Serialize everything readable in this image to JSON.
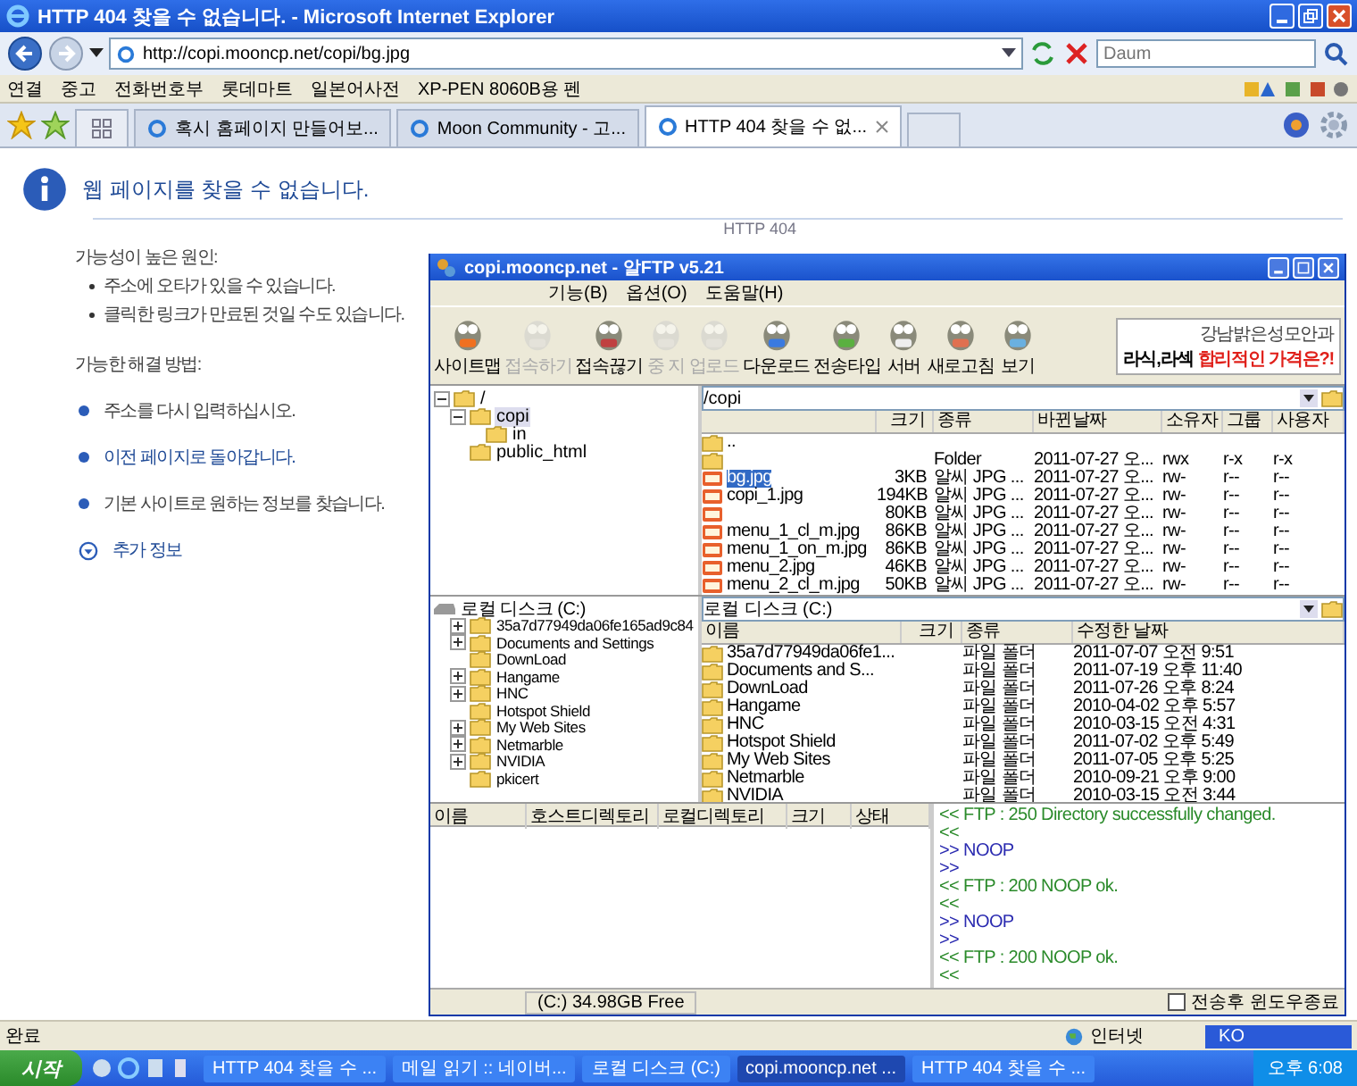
{
  "ie_window": {
    "title": "HTTP 404 찾을 수 없습니다. - Microsoft Internet Explorer"
  },
  "address_bar": {
    "url": "http://copi.mooncp.net/copi/bg.jpg",
    "search_placeholder": "Daum"
  },
  "links_bar": {
    "label": "연결",
    "items": [
      "중고",
      "전화번호부",
      "롯데마트",
      "일본어사전",
      "XP-PEN 8060B용 펜"
    ]
  },
  "tabs": [
    {
      "label": "혹시 홈페이지 만들어보...",
      "selected": false
    },
    {
      "label": "Moon Community - 고...",
      "selected": false
    },
    {
      "label": "HTTP 404 찾을 수 없...",
      "selected": true
    }
  ],
  "error_page": {
    "code": "HTTP 404",
    "heading": "웹 페이지를 찾을 수 없습니다.",
    "causes_label": "가능성이 높은 원인:",
    "causes": [
      "주소에 오타가 있을 수 있습니다.",
      "클릭한 링크가 만료된 것일 수도 있습니다."
    ],
    "solutions_label": "가능한 해결 방법:",
    "solutions": [
      {
        "text": "주소를 다시 입력하십시오.",
        "link": false
      },
      {
        "text": "이전 페이지로 돌아갑니다.",
        "link": true
      },
      {
        "text": "기본 사이트로  원하는 정보를 찾습니다.",
        "link": false
      }
    ],
    "more_info": "추가 정보"
  },
  "ftp": {
    "title": "copi.mooncp.net - 알FTP v5.21",
    "menu": [
      "기능(B)",
      "옵션(O)",
      "도움말(H)"
    ],
    "toolbar": [
      {
        "label": "사이트맵",
        "disabled": false
      },
      {
        "label": "접속하기",
        "disabled": true
      },
      {
        "label": "접속끊기",
        "disabled": false
      },
      {
        "label": "중 지",
        "disabled": true
      },
      {
        "label": "업로드",
        "disabled": true
      },
      {
        "label": "다운로드",
        "disabled": false
      },
      {
        "label": "전송타입",
        "disabled": false
      },
      {
        "label": "서버",
        "disabled": false
      },
      {
        "label": "새로고침",
        "disabled": false
      },
      {
        "label": "보기",
        "disabled": false
      }
    ],
    "ad": {
      "brand": "강남밝은성모안과",
      "headline": "라식,라섹",
      "highlight": "합리적인 가격은?!"
    },
    "remote_tree": [
      {
        "name": "/",
        "selected": false,
        "children": [
          {
            "name": "copi",
            "selected": true,
            "children": [
              {
                "name": "in",
                "selected": false
              }
            ]
          },
          {
            "name": "public_html",
            "selected": false
          }
        ]
      }
    ],
    "remote_path": "/copi",
    "remote_columns": [
      "크기",
      "종류",
      "바뀐날짜",
      "소유자",
      "그룹",
      "사용자"
    ],
    "remote_files": [
      {
        "kind": "folder",
        "name": "..",
        "selected": false
      },
      {
        "kind": "folder",
        "type": "Folder",
        "date": "2011-07-27 오...",
        "owner": "rwx",
        "group": "r-x",
        "user": "r-x"
      },
      {
        "kind": "file",
        "name": "bg.jpg",
        "size": "3KB",
        "type": "알씨 JPG ...",
        "date": "2011-07-27 오...",
        "owner": "rw-",
        "group": "r--",
        "user": "r--",
        "selected": true
      },
      {
        "kind": "file",
        "name": "copi_1.jpg",
        "size": "194KB",
        "type": "알씨 JPG ...",
        "date": "2011-07-27 오...",
        "owner": "rw-",
        "group": "r--",
        "user": "r--",
        "selected": false
      },
      {
        "kind": "file",
        "size": "80KB",
        "type": "알씨 JPG ...",
        "date": "2011-07-27 오...",
        "owner": "rw-",
        "group": "r--",
        "user": "r--"
      },
      {
        "kind": "file",
        "name": "menu_1_cl_m.jpg",
        "size": "86KB",
        "type": "알씨 JPG ...",
        "date": "2011-07-27 오...",
        "owner": "rw-",
        "group": "r--",
        "user": "r--",
        "selected": false
      },
      {
        "kind": "file",
        "name": "menu_1_on_m.jpg",
        "size": "86KB",
        "type": "알씨 JPG ...",
        "date": "2011-07-27 오...",
        "owner": "rw-",
        "group": "r--",
        "user": "r--",
        "selected": false
      },
      {
        "kind": "file",
        "name": "menu_2.jpg",
        "size": "46KB",
        "type": "알씨 JPG ...",
        "date": "2011-07-27 오...",
        "owner": "rw-",
        "group": "r--",
        "user": "r--",
        "selected": false
      },
      {
        "kind": "file",
        "name": "menu_2_cl_m.jpg",
        "size": "50KB",
        "type": "알씨 JPG ...",
        "date": "2011-07-27 오...",
        "owner": "rw-",
        "group": "r--",
        "user": "r--",
        "selected": false
      }
    ],
    "local_tree": [
      {
        "name": "로컬 디스크 (C:)",
        "children": [
          {
            "name": "35a7d77949da06fe165ad9c84",
            "expandable": true
          },
          {
            "name": "Documents and Settings",
            "expandable": true
          },
          {
            "name": "DownLoad",
            "expandable": false
          },
          {
            "name": "Hangame",
            "expandable": true
          },
          {
            "name": "HNC",
            "expandable": true
          },
          {
            "name": "Hotspot Shield",
            "expandable": false
          },
          {
            "name": "My Web Sites",
            "expandable": true
          },
          {
            "name": "Netmarble",
            "expandable": true
          },
          {
            "name": "NVIDIA",
            "expandable": true
          },
          {
            "name": "pkicert",
            "expandable": false
          }
        ]
      }
    ],
    "local_path": "로컬 디스크 (C:)",
    "local_columns": [
      "이름",
      "크기",
      "종류",
      "수정한 날짜"
    ],
    "local_files": [
      {
        "name": "35a7d77949da06fe1...",
        "type": "파일 폴더",
        "date": "2011-07-07 오전 9:51"
      },
      {
        "name": "Documents and S...",
        "type": "파일 폴더",
        "date": "2011-07-19 오후 11:40"
      },
      {
        "name": "DownLoad",
        "type": "파일 폴더",
        "date": "2011-07-26 오후 8:24"
      },
      {
        "name": "Hangame",
        "type": "파일 폴더",
        "date": "2010-04-02 오후 5:57"
      },
      {
        "name": "HNC",
        "type": "파일 폴더",
        "date": "2010-03-15 오전 4:31"
      },
      {
        "name": "Hotspot Shield",
        "type": "파일 폴더",
        "date": "2011-07-02 오후 5:49"
      },
      {
        "name": "My Web Sites",
        "type": "파일 폴더",
        "date": "2011-07-05 오후 5:25"
      },
      {
        "name": "Netmarble",
        "type": "파일 폴더",
        "date": "2010-09-21 오후 9:00"
      },
      {
        "name": "NVIDIA",
        "type": "파일 폴더",
        "date": "2010-03-15 오전 3:44"
      }
    ],
    "queue_columns": [
      "이름",
      "호스트디렉토리",
      "로컬디렉토리",
      "크기",
      "상태"
    ],
    "log": [
      {
        "kind": "received",
        "text": "<< FTP : 250 Directory successfully changed."
      },
      {
        "kind": "received",
        "text": "<<"
      },
      {
        "kind": "sent",
        "text": ">> NOOP"
      },
      {
        "kind": "sent",
        "text": ">>"
      },
      {
        "kind": "received",
        "text": "<< FTP : 200 NOOP ok."
      },
      {
        "kind": "received",
        "text": "<<"
      },
      {
        "kind": "sent",
        "text": ">> NOOP"
      },
      {
        "kind": "sent",
        "text": ">>"
      },
      {
        "kind": "received",
        "text": "<< FTP : 200 NOOP ok."
      },
      {
        "kind": "received",
        "text": "<<"
      }
    ],
    "disk_free": "(C:)  34.98GB Free",
    "close_after_transfer": {
      "label": "전송후 윈도우종료",
      "checked": false
    }
  },
  "ie_status_bar": {
    "text": "완료",
    "zone": "인터넷"
  },
  "taskbar": {
    "start": "시작",
    "tasks": [
      {
        "label": "HTTP 404 찾을 수 ...",
        "selected": false
      },
      {
        "label": "메일 읽기 :: 네이버...",
        "selected": false
      },
      {
        "label": "로컬 디스크 (C:)",
        "selected": false
      },
      {
        "label": "copi.mooncp.net ...",
        "selected": true
      },
      {
        "label": "HTTP 404 찾을 수 ...",
        "selected": false
      }
    ],
    "language": "KO",
    "clock": "오후 6:08"
  }
}
